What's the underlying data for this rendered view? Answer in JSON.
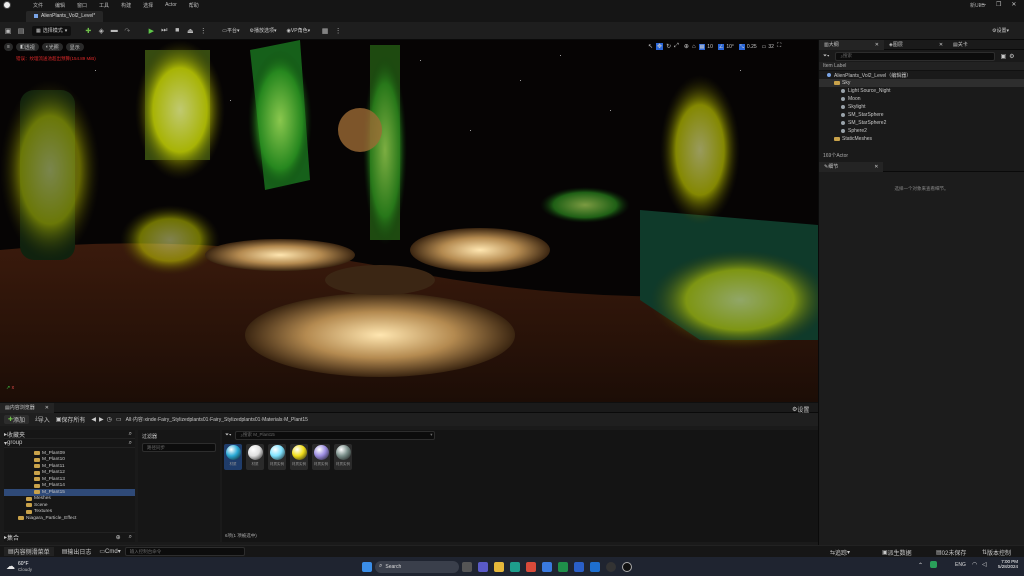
{
  "app": {
    "title_tab": "AlienPlants_Vol2_Level",
    "window_name": "新UE5"
  },
  "menu": [
    "文件",
    "编辑",
    "窗口",
    "工具",
    "构建",
    "选择",
    "Actor",
    "帮助"
  ],
  "toolbar": {
    "save_label": "",
    "mode_label": "选择模式",
    "platform_label": "平台",
    "play_label": "播放选项",
    "vp_label": "VP角色",
    "settings_label": "设置"
  },
  "viewport": {
    "view_label": "透视",
    "lit_label": "光照",
    "show_label": "显示",
    "warning": "错误：纹理流送池超出预算(154.89 MiB)",
    "grid_value": "10",
    "angle_value": "10°",
    "scale_value": "0.25",
    "camera_speed": "32"
  },
  "outliner": {
    "tab": "大纲",
    "tab2": "图层",
    "tab3": "关卡",
    "search_placeholder": "搜索",
    "column": "Item Label",
    "items": [
      {
        "label": "AlienPlants_Vol2_Level（编辑器）",
        "indent": 0,
        "type": "level"
      },
      {
        "label": "Sky",
        "indent": 1,
        "type": "folder",
        "selected": true
      },
      {
        "label": "Light Source_Night",
        "indent": 2,
        "type": "actor"
      },
      {
        "label": "Moon",
        "indent": 2,
        "type": "actor"
      },
      {
        "label": "Skylight",
        "indent": 2,
        "type": "actor"
      },
      {
        "label": "SM_StarSphere",
        "indent": 2,
        "type": "actor"
      },
      {
        "label": "SM_StarSphere2",
        "indent": 2,
        "type": "actor"
      },
      {
        "label": "Sphere2",
        "indent": 2,
        "type": "actor"
      },
      {
        "label": "StaticMeshes",
        "indent": 1,
        "type": "folder"
      }
    ],
    "count": "169个Actor"
  },
  "details": {
    "tab": "细节",
    "empty_msg": "选择一个对象来查看细节。"
  },
  "content_browser": {
    "tab": "内容浏览器",
    "add_label": "添加",
    "import_label": "导入",
    "save_all_label": "保存所有",
    "breadcrumb": [
      "All",
      "内容",
      "xinde",
      "Fairy_Stylizedplants01",
      "Fairy_Stylizedplants01",
      "Materials",
      "M_Plant15"
    ],
    "settings_label": "设置",
    "favorites_label": "收藏夹",
    "root_label": "group",
    "tree": [
      "M_Plant09",
      "M_Plant10",
      "M_Plant11",
      "M_Plant12",
      "M_Plant13",
      "M_Plant14",
      "M_Plant15",
      "Meshes",
      "Scene",
      "Textures",
      "Niagara_Particle_Effect"
    ],
    "collections_label": "集合",
    "filters_label": "过滤器",
    "filter_search": "路径同步",
    "search_placeholder": "搜索 M_Plant15",
    "assets": [
      {
        "label": "材质",
        "color": "#2aa9d6"
      },
      {
        "label": "材质",
        "color": "#e0e0e0"
      },
      {
        "label": "材质实例",
        "color": "#7fe3ff"
      },
      {
        "label": "材质实例",
        "color": "#f2df1a"
      },
      {
        "label": "材质实例",
        "color": "#9b8ce0"
      },
      {
        "label": "材质实例",
        "color": "#7a8f8a"
      }
    ],
    "status": "6项(1 项被选中)"
  },
  "statusbar": {
    "drawer": "内容侧滑菜单",
    "output": "输出日志",
    "cmd": "Cmd",
    "cmd_placeholder": "输入控制台命令",
    "trace": "追踪",
    "derived": "派生数据",
    "unsaved": "02未保存",
    "source": "版本控制"
  },
  "taskbar": {
    "weather_temp": "60°F",
    "weather_desc": "Cloudy",
    "search": "Search",
    "lang": "ENG",
    "time": "7:00 PM",
    "date": "5/28/2024"
  }
}
